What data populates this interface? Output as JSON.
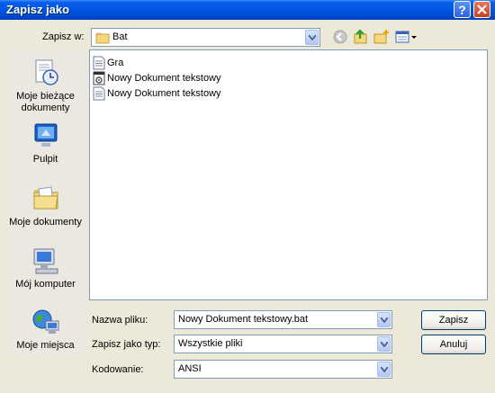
{
  "window": {
    "title": "Zapisz jako"
  },
  "toolbar": {
    "save_in_label": "Zapisz w:",
    "current_folder": "Bat",
    "icons": [
      "back-icon",
      "up-folder-icon",
      "new-folder-icon",
      "views-menu-icon"
    ]
  },
  "places": [
    {
      "label": "Moje bieżące\ndokumenty",
      "icon": "recent-documents-icon"
    },
    {
      "label": "Pulpit",
      "icon": "desktop-icon"
    },
    {
      "label": "Moje dokumenty",
      "icon": "my-documents-icon"
    },
    {
      "label": "Mój komputer",
      "icon": "my-computer-icon"
    },
    {
      "label": "Moje miejsca",
      "icon": "network-places-icon"
    }
  ],
  "files": [
    {
      "name": "Gra",
      "icon": "text-file-icon"
    },
    {
      "name": "Nowy Dokument tekstowy",
      "icon": "batch-file-icon"
    },
    {
      "name": "Nowy Dokument tekstowy",
      "icon": "text-file-icon"
    }
  ],
  "form": {
    "filename_label": "Nazwa pliku:",
    "filename_value": "Nowy Dokument tekstowy.bat",
    "type_label": "Zapisz jako typ:",
    "type_value": "Wszystkie pliki",
    "encoding_label": "Kodowanie:",
    "encoding_value": "ANSI"
  },
  "buttons": {
    "save": "Zapisz",
    "cancel": "Anuluj"
  },
  "colors": {
    "titlebar": "#0054e3",
    "dialog": "#ece9d8",
    "border": "#7f9db9"
  }
}
